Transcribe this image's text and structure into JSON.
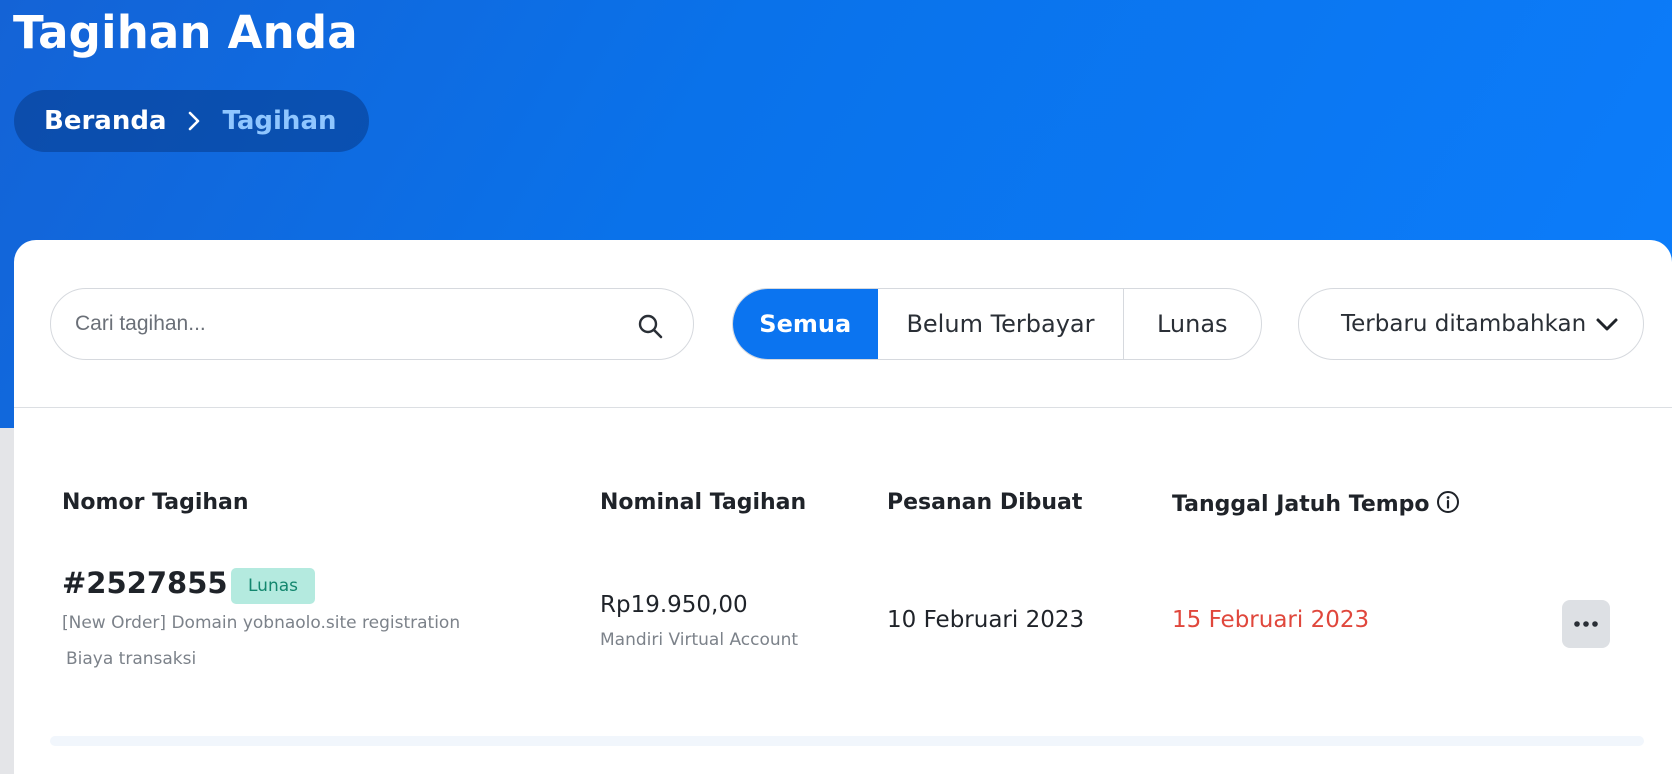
{
  "page": {
    "title": "Tagihan Anda",
    "breadcrumb": {
      "home": "Beranda",
      "current": "Tagihan"
    }
  },
  "toolbar": {
    "search_placeholder": "Cari tagihan...",
    "filters": [
      "Semua",
      "Belum Terbayar",
      "Lunas"
    ],
    "active_filter": "Semua",
    "sort_label": "Terbaru ditambahkan"
  },
  "table": {
    "headers": {
      "invoice": "Nomor Tagihan",
      "amount": "Nominal Tagihan",
      "created": "Pesanan Dibuat",
      "due": "Tanggal Jatuh Tempo"
    },
    "rows": [
      {
        "number": "#2527855",
        "status": "Lunas",
        "description": "[New Order] Domain yobnaolo.site registration",
        "fee_note": "Biaya transaksi",
        "amount": "Rp19.950,00",
        "method": "Mandiri Virtual Account",
        "created": "10 Februari 2023",
        "due": "15 Februari 2023"
      }
    ]
  },
  "colors": {
    "primary": "#0b74f0",
    "due_red": "#e0473c",
    "badge_bg": "#b4eadf",
    "badge_text": "#13876e"
  },
  "icons": {
    "breadcrumb_separator": "chevron-right-icon",
    "search": "search-icon",
    "sort": "chevron-down-icon",
    "due_info": "info-icon",
    "row_actions": "more-horizontal-icon"
  }
}
